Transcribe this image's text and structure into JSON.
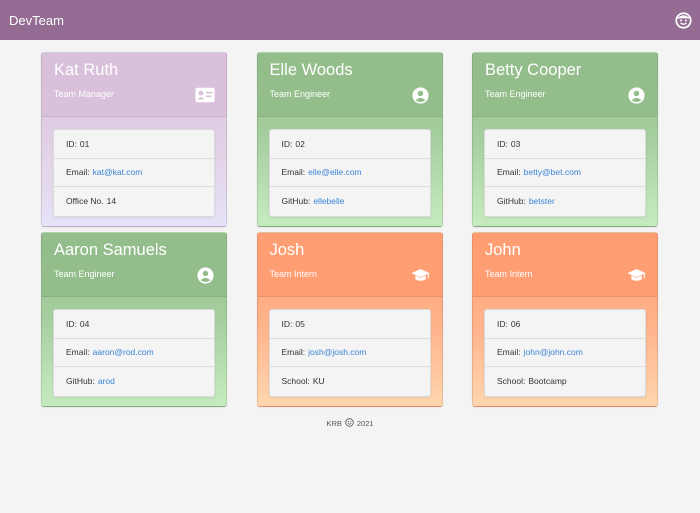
{
  "navbar": {
    "brand": "DevTeam",
    "avatar_icon": "smiley-face-icon"
  },
  "team": [
    {
      "name": "Kat Ruth",
      "role": "Team Manager",
      "role_key": "manager",
      "icon": "id-card-icon",
      "details": [
        {
          "label": "ID:",
          "value": "01",
          "link": false
        },
        {
          "label": "Email:",
          "value": "kat@kat.com",
          "link": true
        },
        {
          "label": "Office No.",
          "value": "14",
          "link": false
        }
      ]
    },
    {
      "name": "Elle Woods",
      "role": "Team Engineer",
      "role_key": "engineer",
      "icon": "user-circle-icon",
      "details": [
        {
          "label": "ID:",
          "value": "02",
          "link": false
        },
        {
          "label": "Email:",
          "value": "elle@elle.com",
          "link": true
        },
        {
          "label": "GitHub:",
          "value": "ellebelle",
          "link": true
        }
      ]
    },
    {
      "name": "Betty Cooper",
      "role": "Team Engineer",
      "role_key": "engineer",
      "icon": "user-circle-icon",
      "details": [
        {
          "label": "ID:",
          "value": "03",
          "link": false
        },
        {
          "label": "Email:",
          "value": "betty@bet.com",
          "link": true
        },
        {
          "label": "GitHub:",
          "value": "betster",
          "link": true
        }
      ]
    },
    {
      "name": "Aaron Samuels",
      "role": "Team Engineer",
      "role_key": "engineer",
      "icon": "user-circle-icon",
      "details": [
        {
          "label": "ID:",
          "value": "04",
          "link": false
        },
        {
          "label": "Email:",
          "value": "aaron@rod.com",
          "link": true
        },
        {
          "label": "GitHub:",
          "value": "arod",
          "link": true
        }
      ]
    },
    {
      "name": "Josh",
      "role": "Team Intern",
      "role_key": "intern",
      "icon": "graduation-cap-icon",
      "details": [
        {
          "label": "ID:",
          "value": "05",
          "link": false
        },
        {
          "label": "Email:",
          "value": "josh@josh.com",
          "link": true
        },
        {
          "label": "School:",
          "value": "KU",
          "link": false
        }
      ]
    },
    {
      "name": "John",
      "role": "Team Intern",
      "role_key": "intern",
      "icon": "graduation-cap-icon",
      "details": [
        {
          "label": "ID:",
          "value": "06",
          "link": false
        },
        {
          "label": "Email:",
          "value": "john@john.com",
          "link": true
        },
        {
          "label": "School:",
          "value": "Bootcamp",
          "link": false
        }
      ]
    }
  ],
  "footer": {
    "left": "KRB",
    "icon": "smiley-face-icon",
    "right": "2021"
  }
}
